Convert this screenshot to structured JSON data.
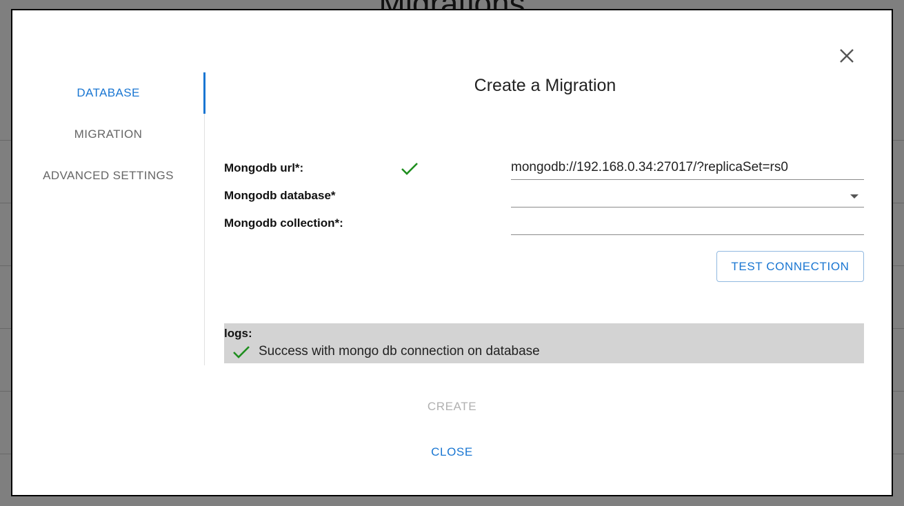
{
  "background": {
    "page_title": "Migrations"
  },
  "dialog": {
    "title": "Create a Migration",
    "tabs": [
      {
        "label": "DATABASE",
        "active": true
      },
      {
        "label": "MIGRATION",
        "active": false
      },
      {
        "label": "ADVANCED SETTINGS",
        "active": false
      }
    ],
    "form": {
      "url_label": "Mongodb url*:",
      "url_value": "mongodb://192.168.0.34:27017/?replicaSet=rs0",
      "url_valid_icon": "check-icon",
      "database_label": "Mongodb database*",
      "database_value": "",
      "collection_label": "Mongodb collection*:",
      "collection_value": ""
    },
    "test_connection_label": "TEST CONNECTION",
    "logs": {
      "title": "logs:",
      "entries": [
        {
          "icon": "check-icon",
          "text": "Success with mongo db connection on database"
        }
      ]
    },
    "create_label": "CREATE",
    "close_label": "CLOSE"
  },
  "colors": {
    "accent": "#1976d2",
    "success": "#1e8e1e",
    "logs_background": "#d3d3d3",
    "disabled": "#b0b0b0"
  }
}
